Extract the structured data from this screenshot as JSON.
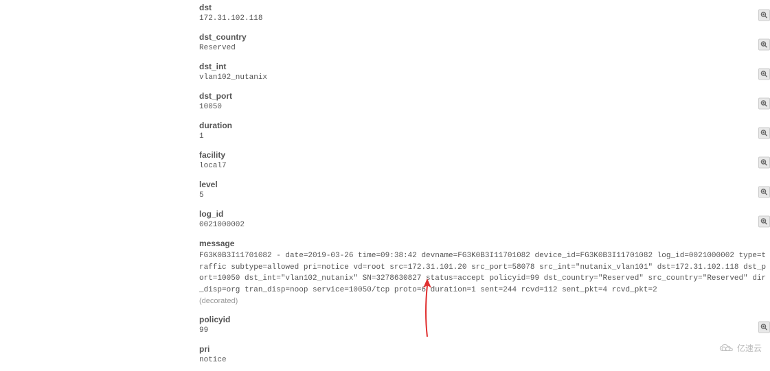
{
  "fields": [
    {
      "label": "dst",
      "value": "172.31.102.118",
      "zoom": true
    },
    {
      "label": "dst_country",
      "value": "Reserved",
      "zoom": true
    },
    {
      "label": "dst_int",
      "value": "vlan102_nutanix",
      "zoom": true
    },
    {
      "label": "dst_port",
      "value": "10050",
      "zoom": true
    },
    {
      "label": "duration",
      "value": "1",
      "zoom": true
    },
    {
      "label": "facility",
      "value": "local7",
      "zoom": true
    },
    {
      "label": "level",
      "value": "5",
      "zoom": true
    },
    {
      "label": "log_id",
      "value": "0021000002",
      "zoom": true
    }
  ],
  "message": {
    "label": "message",
    "value": "FG3K0B3I11701082 - date=2019-03-26 time=09:38:42 devname=FG3K0B3I11701082 device_id=FG3K0B3I11701082 log_id=0021000002 type=traffic subtype=allowed pri=notice vd=root src=172.31.101.20 src_port=58078 src_int=\"nutanix_vlan101\" dst=172.31.102.118 dst_port=10050 dst_int=\"vlan102_nutanix\" SN=3278630827 status=accept policyid=99 dst_country=\"Reserved\" src_country=\"Reserved\" dir_disp=org tran_disp=noop service=10050/tcp proto=6 duration=1 sent=244 rcvd=112 sent_pkt=4 rcvd_pkt=2",
    "decorated": "(decorated)"
  },
  "tail_fields": [
    {
      "label": "policyid",
      "value": "99",
      "zoom": true
    },
    {
      "label": "pri",
      "value": "notice",
      "zoom": false
    }
  ],
  "watermark": "亿速云",
  "annotation": {
    "color": "#e03030"
  }
}
